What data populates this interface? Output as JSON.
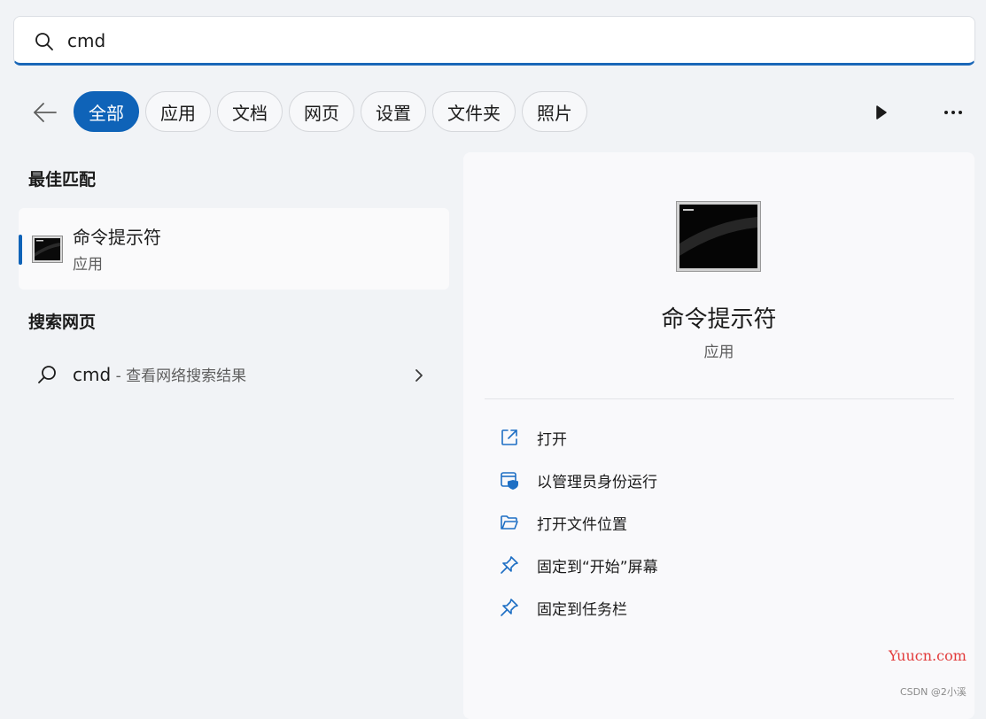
{
  "search": {
    "value": "cmd",
    "placeholder": ""
  },
  "filters": {
    "tabs": [
      {
        "label": "全部",
        "active": true
      },
      {
        "label": "应用"
      },
      {
        "label": "文档"
      },
      {
        "label": "网页"
      },
      {
        "label": "设置"
      },
      {
        "label": "文件夹"
      },
      {
        "label": "照片"
      }
    ],
    "accent_color": "#0f63b8"
  },
  "results": {
    "best_match_title": "最佳匹配",
    "best_match": {
      "name": "命令提示符",
      "type": "应用",
      "icon": "terminal-icon"
    },
    "web_title": "搜索网页",
    "web_item": {
      "query": "cmd",
      "suffix": " - 查看网络搜索结果"
    }
  },
  "detail": {
    "name": "命令提示符",
    "type": "应用",
    "actions": [
      {
        "label": "打开",
        "icon": "open-external-icon"
      },
      {
        "label": "以管理员身份运行",
        "icon": "admin-shield-icon"
      },
      {
        "label": "打开文件位置",
        "icon": "folder-icon"
      },
      {
        "label": "固定到“开始”屏幕",
        "icon": "pin-icon"
      },
      {
        "label": "固定到任务栏",
        "icon": "pin-icon"
      }
    ]
  },
  "watermark": {
    "site": "Yuucn.com",
    "credit": "CSDN @2小溪"
  }
}
